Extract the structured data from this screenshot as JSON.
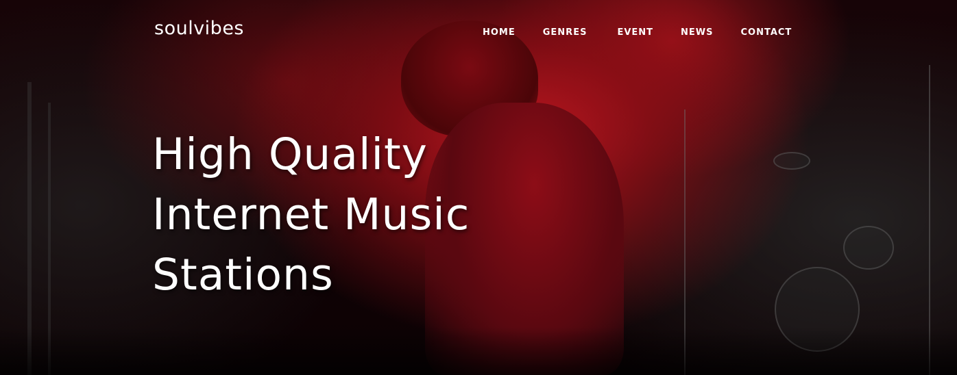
{
  "header": {
    "brand": "soulvibes",
    "nav": [
      "HOME",
      "GENRES",
      "EVENT",
      "NEWS",
      "CONTACT"
    ]
  },
  "hero": {
    "headline_lines": [
      "High Quality",
      "Internet Music",
      "Stations"
    ]
  },
  "colors": {
    "accent_red": "#c81822",
    "background": "#0c0204",
    "text": "#ffffff"
  }
}
